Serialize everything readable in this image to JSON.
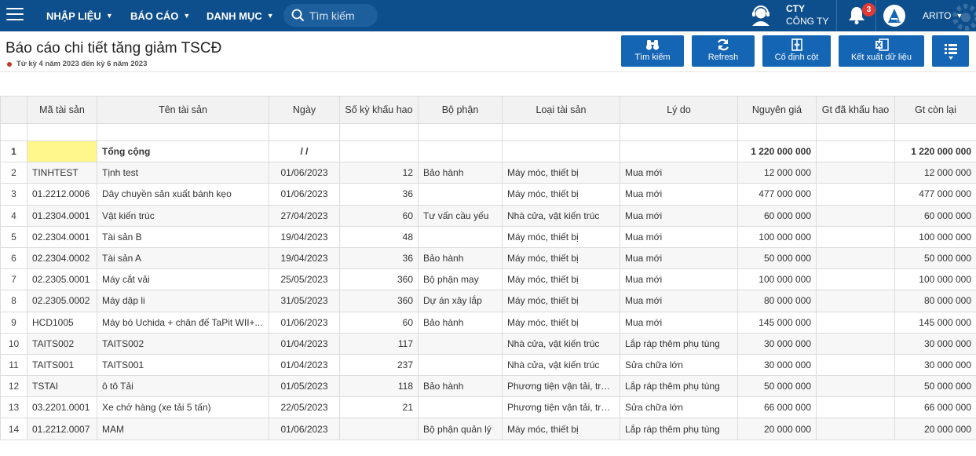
{
  "nav": {
    "menus": [
      {
        "label": "NHẬP LIỆU"
      },
      {
        "label": "BÁO CÁO"
      },
      {
        "label": "DANH MỤC"
      }
    ],
    "search_placeholder": "Tìm kiếm",
    "company_line1": "CTY",
    "company_line2": "CÔNG TY",
    "notification_count": "3",
    "user_name": "ARITO",
    "avatar_text": "rito",
    "colors": {
      "navbar": "#0d4e8c",
      "button": "#1565b5",
      "badge": "#e53935",
      "total_highlight": "#fff68c"
    }
  },
  "page": {
    "title": "Báo cáo chi tiết tăng giảm TSCĐ",
    "subtitle": "Từ kỳ 4 năm 2023 đến kỳ 6 năm 2023"
  },
  "toolbar": {
    "search_label": "Tìm kiếm",
    "refresh_label": "Refresh",
    "pin_columns_label": "Cố định cột",
    "export_label": "Kết xuất dữ liệu"
  },
  "table": {
    "columns": [
      "Mã tài sản",
      "Tên tài sản",
      "Ngày",
      "Số kỳ khấu hao",
      "Bộ phận",
      "Loại tài sản",
      "Lý do",
      "Nguyên giá",
      "Gt đã khấu hao",
      "Gt còn lại"
    ],
    "total": {
      "rn": "1",
      "code": "",
      "name": "Tổng cộng",
      "date": "/ /",
      "periods": "",
      "dept": "",
      "type": "",
      "reason": "",
      "cost": "1 220 000 000",
      "depr": "",
      "remain": "1 220 000 000"
    },
    "rows": [
      {
        "rn": "2",
        "code": "TINHTEST",
        "name": "Tịnh test",
        "date": "01/06/2023",
        "periods": "12",
        "dept": "Bảo hành",
        "type": "Máy móc, thiết bị",
        "reason": "Mua mới",
        "cost": "12 000 000",
        "depr": "",
        "remain": "12 000 000"
      },
      {
        "rn": "3",
        "code": "01.2212.0006",
        "name": "Dây chuyền sản xuất bánh kẹo",
        "date": "01/06/2023",
        "periods": "36",
        "dept": "",
        "type": "Máy móc, thiết bị",
        "reason": "Mua mới",
        "cost": "477 000 000",
        "depr": "",
        "remain": "477 000 000"
      },
      {
        "rn": "4",
        "code": "01.2304.0001",
        "name": "Vật kiến trúc",
        "date": "27/04/2023",
        "periods": "60",
        "dept": "Tư vấn cầu yếu",
        "type": "Nhà cửa, vật kiến trúc",
        "reason": "Mua mới",
        "cost": "60 000 000",
        "depr": "",
        "remain": "60 000 000"
      },
      {
        "rn": "5",
        "code": "02.2304.0001",
        "name": "Tài sản B",
        "date": "19/04/2023",
        "periods": "48",
        "dept": "",
        "type": "Máy móc, thiết bị",
        "reason": "Mua mới",
        "cost": "100 000 000",
        "depr": "",
        "remain": "100 000 000"
      },
      {
        "rn": "6",
        "code": "02.2304.0002",
        "name": "Tài sản A",
        "date": "19/04/2023",
        "periods": "36",
        "dept": "Bảo hành",
        "type": "Máy móc, thiết bị",
        "reason": "Mua mới",
        "cost": "50 000 000",
        "depr": "",
        "remain": "50 000 000"
      },
      {
        "rn": "7",
        "code": "02.2305.0001",
        "name": "Máy cắt vải",
        "date": "25/05/2023",
        "periods": "360",
        "dept": "Bộ phận may",
        "type": "Máy móc, thiết bị",
        "reason": "Mua mới",
        "cost": "100 000 000",
        "depr": "",
        "remain": "100 000 000"
      },
      {
        "rn": "8",
        "code": "02.2305.0002",
        "name": "Máy dập li",
        "date": "31/05/2023",
        "periods": "360",
        "dept": "Dự án xây lắp",
        "type": "Máy móc, thiết bị",
        "reason": "Mua mới",
        "cost": "80 000 000",
        "depr": "",
        "remain": "80 000 000"
      },
      {
        "rn": "9",
        "code": "HCD1005",
        "name": "Máy bó Uchida + chân đế TaPit WII+...",
        "date": "01/06/2023",
        "periods": "60",
        "dept": "Bảo hành",
        "type": "Máy móc, thiết bị",
        "reason": "Mua mới",
        "cost": "145 000 000",
        "depr": "",
        "remain": "145 000 000"
      },
      {
        "rn": "10",
        "code": "TAITS002",
        "name": "TAITS002",
        "date": "01/04/2023",
        "periods": "117",
        "dept": "",
        "type": "Nhà cửa, vật kiến trúc",
        "reason": "Lắp ráp thêm phụ tùng",
        "cost": "30 000 000",
        "depr": "",
        "remain": "30 000 000"
      },
      {
        "rn": "11",
        "code": "TAITS001",
        "name": "TAITS001",
        "date": "01/04/2023",
        "periods": "237",
        "dept": "",
        "type": "Nhà cửa, vật kiến trúc",
        "reason": "Sửa chữa lớn",
        "cost": "30 000 000",
        "depr": "",
        "remain": "30 000 000"
      },
      {
        "rn": "12",
        "code": "TSTAI",
        "name": "ô tô Tải",
        "date": "01/05/2023",
        "periods": "118",
        "dept": "Bảo hành",
        "type": "Phương tiện vận tải, truy...",
        "reason": "Lắp ráp thêm phụ tùng",
        "cost": "50 000 000",
        "depr": "",
        "remain": "50 000 000"
      },
      {
        "rn": "13",
        "code": "03.2201.0001",
        "name": "Xe chở hàng (xe tải 5 tấn)",
        "date": "22/05/2023",
        "periods": "21",
        "dept": "",
        "type": "Phương tiện vận tải, truy...",
        "reason": "Sửa chữa lớn",
        "cost": "66 000 000",
        "depr": "",
        "remain": "66 000 000"
      },
      {
        "rn": "14",
        "code": "01.2212.0007",
        "name": "MAM",
        "date": "01/06/2023",
        "periods": "",
        "dept": "Bộ phận quản lý",
        "type": "Máy móc, thiết bị",
        "reason": "Lắp ráp thêm phụ tùng",
        "cost": "20 000 000",
        "depr": "",
        "remain": "20 000 000"
      }
    ]
  }
}
